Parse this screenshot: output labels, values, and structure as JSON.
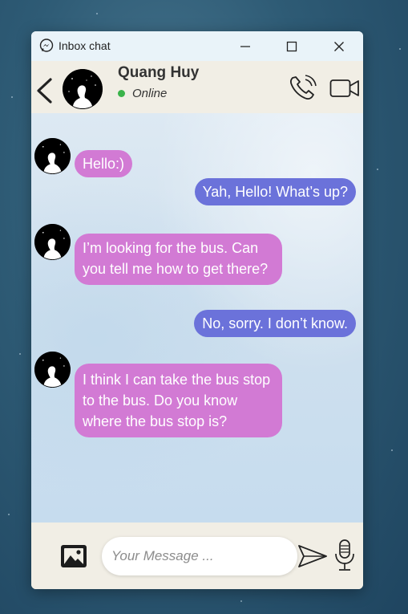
{
  "window": {
    "title": "Inbox chat",
    "logo_icon": "messenger-icon",
    "minimize_icon": "minimize-icon",
    "maximize_icon": "maximize-icon",
    "close_icon": "close-icon"
  },
  "header": {
    "contact_name": "Quang Huy",
    "status": "Online",
    "status_color": "#3ab34a"
  },
  "messages": [
    {
      "from": "them",
      "text": "Hello:)"
    },
    {
      "from": "me",
      "text": "Yah, Hello! What’s up?"
    },
    {
      "from": "them",
      "text": "I’m looking for the bus. Can\nyou tell me how to get there?"
    },
    {
      "from": "me",
      "text": "No, sorry. I don’t know."
    },
    {
      "from": "them",
      "text": "I think I can take the bus stop\nto the bus. Do you know\nwhere the bus stop is?"
    }
  ],
  "composer": {
    "placeholder": "Your Message ...",
    "value": ""
  },
  "colors": {
    "received_bubble": "#d27ad4",
    "sent_bubble": "#6b72da",
    "titlebar": "#e9f3f9",
    "header": "#f1eee5"
  }
}
